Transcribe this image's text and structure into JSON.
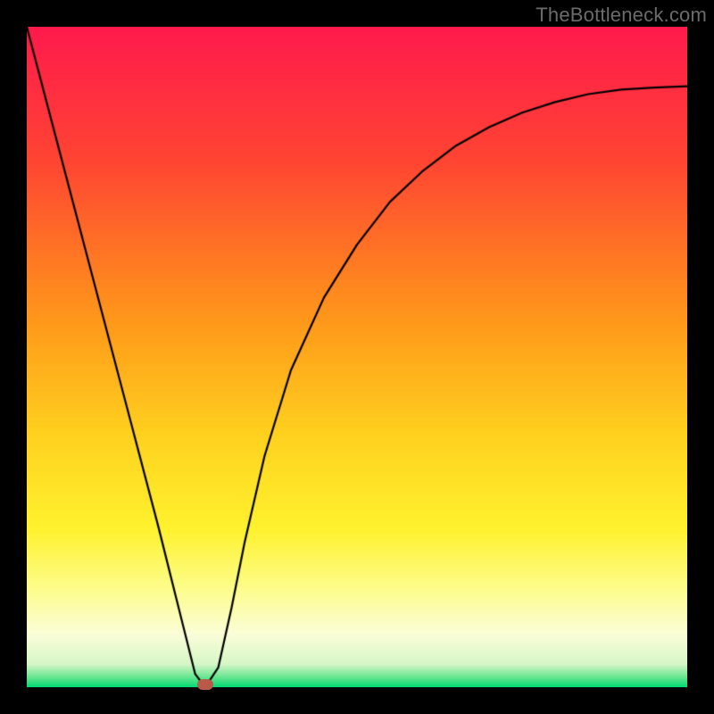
{
  "watermark": "TheBottleneck.com",
  "colors": {
    "frame": "#000000",
    "watermark": "#6b6b6b",
    "curve": "#000000",
    "marker": "#b85a4a",
    "gradient_stops": [
      {
        "pos": 0.0,
        "color": "#ff1a4d"
      },
      {
        "pos": 0.2,
        "color": "#ff4433"
      },
      {
        "pos": 0.45,
        "color": "#ff9a1a"
      },
      {
        "pos": 0.62,
        "color": "#ffd21f"
      },
      {
        "pos": 0.76,
        "color": "#fff22e"
      },
      {
        "pos": 0.85,
        "color": "#fdfd8a"
      },
      {
        "pos": 0.92,
        "color": "#fbfdd8"
      },
      {
        "pos": 0.965,
        "color": "#d6f7c8"
      },
      {
        "pos": 0.985,
        "color": "#66e68f"
      },
      {
        "pos": 1.0,
        "color": "#00d873"
      }
    ]
  },
  "chart_data": {
    "type": "line",
    "title": "",
    "xlabel": "",
    "ylabel": "",
    "xlim": [
      0,
      1
    ],
    "ylim": [
      0,
      1
    ],
    "series": [
      {
        "name": "bottleneck-curve",
        "x": [
          0.0,
          0.05,
          0.1,
          0.15,
          0.2,
          0.23,
          0.255,
          0.27,
          0.29,
          0.31,
          0.33,
          0.36,
          0.4,
          0.45,
          0.5,
          0.55,
          0.6,
          0.65,
          0.7,
          0.75,
          0.8,
          0.85,
          0.9,
          0.95,
          1.0
        ],
        "values": [
          1.0,
          0.81,
          0.62,
          0.43,
          0.24,
          0.12,
          0.02,
          0.0,
          0.03,
          0.12,
          0.22,
          0.35,
          0.48,
          0.59,
          0.67,
          0.735,
          0.782,
          0.82,
          0.848,
          0.87,
          0.886,
          0.898,
          0.905,
          0.908,
          0.91
        ]
      }
    ],
    "marker": {
      "x": 0.27,
      "y": 0.0
    },
    "grid": false,
    "legend": false
  }
}
